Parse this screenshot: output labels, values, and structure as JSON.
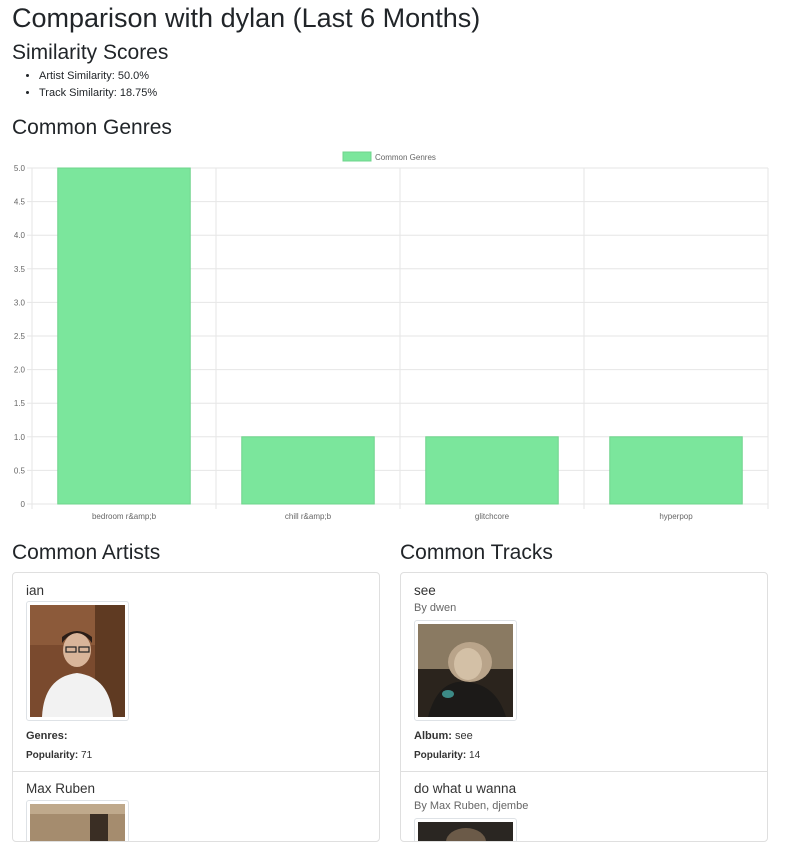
{
  "page": {
    "title": "Comparison with dylan (Last 6 Months)"
  },
  "similarity": {
    "heading": "Similarity Scores",
    "items": [
      {
        "label": "Artist Similarity:",
        "value": "50.0%"
      },
      {
        "label": "Track Similarity:",
        "value": "18.75%"
      }
    ]
  },
  "genres": {
    "heading": "Common Genres"
  },
  "chart_data": {
    "type": "bar",
    "categories": [
      "bedroom r&amp;b",
      "chill r&amp;b",
      "glitchcore",
      "hyperpop"
    ],
    "series": [
      {
        "name": "Common Genres",
        "values": [
          5,
          1,
          1,
          1
        ],
        "color": "#7be69c"
      }
    ],
    "ylim": [
      0,
      5
    ],
    "yticks": [
      "0",
      "0.5",
      "1.0",
      "1.5",
      "2.0",
      "2.5",
      "3.0",
      "3.5",
      "4.0",
      "4.5",
      "5.0"
    ],
    "legend_position": "top-center",
    "grid": true
  },
  "artists": {
    "heading": "Common Artists",
    "items": [
      {
        "name": "ian",
        "genres_label": "Genres:",
        "popularity_label": "Popularity:",
        "popularity": "71"
      },
      {
        "name": "Max Ruben"
      }
    ]
  },
  "tracks": {
    "heading": "Common Tracks",
    "items": [
      {
        "name": "see",
        "by": "By dwen",
        "album_label": "Album:",
        "album": "see",
        "popularity_label": "Popularity:",
        "popularity": "14"
      },
      {
        "name": "do what u wanna",
        "by": "By Max Ruben, djembe"
      }
    ]
  },
  "colors": {
    "bar": "#7be69c",
    "bar_border": "#6fd48c",
    "grid": "#e6e6e6",
    "text": "#212529"
  }
}
